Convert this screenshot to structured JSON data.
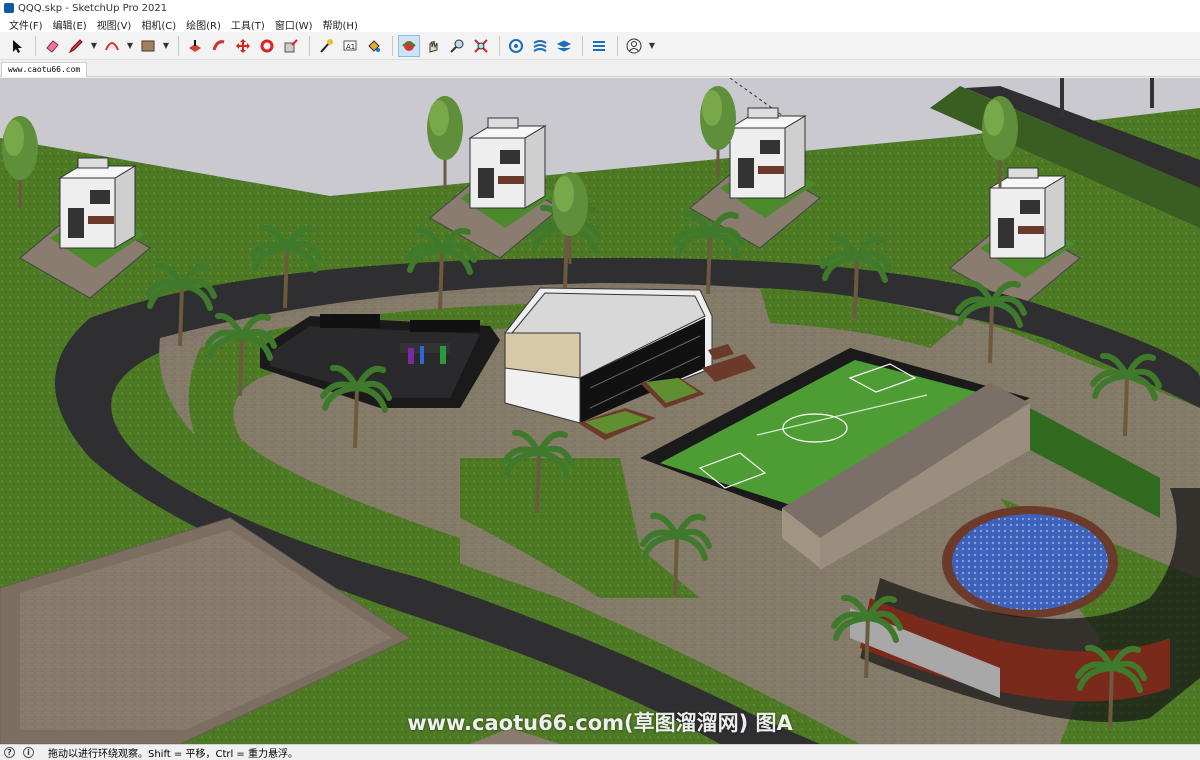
{
  "window": {
    "title": "QQQ.skp - SketchUp Pro 2021"
  },
  "menu": [
    "文件(F)",
    "编辑(E)",
    "视图(V)",
    "相机(C)",
    "绘图(R)",
    "工具(T)",
    "窗口(W)",
    "帮助(H)"
  ],
  "toolbar": {
    "icons": [
      "select-icon",
      "eraser-icon",
      "pencil-icon",
      "arc-icon",
      "rectangle-icon",
      "push-pull-icon",
      "follow-me-icon",
      "move-icon",
      "rotate-icon",
      "scale-icon",
      "tape-measure-icon",
      "text-icon",
      "paint-bucket-icon",
      "orbit-icon",
      "pan-icon",
      "zoom-icon",
      "zoom-extents-icon",
      "components-icon",
      "extension-icon",
      "layers-icon",
      "sandbox-icon",
      "account-icon"
    ],
    "active": "orbit-icon"
  },
  "scene_tab": {
    "label": "www.caotu66.com"
  },
  "viewport": {
    "watermark": "www.caotu66.com(草图溜溜网) 图A"
  },
  "statusbar": {
    "icons": [
      "geo-icon",
      "info-icon"
    ],
    "text": "拖动以进行环绕观察。Shift = 平移，Ctrl = 重力悬浮。"
  },
  "colors": {
    "grass": "#4e7a26",
    "road": "#2f2f31",
    "paving": "#8a7d6f",
    "sky": "#c9c9cf",
    "field": "#4e9d34",
    "water": "#3d61b8"
  }
}
